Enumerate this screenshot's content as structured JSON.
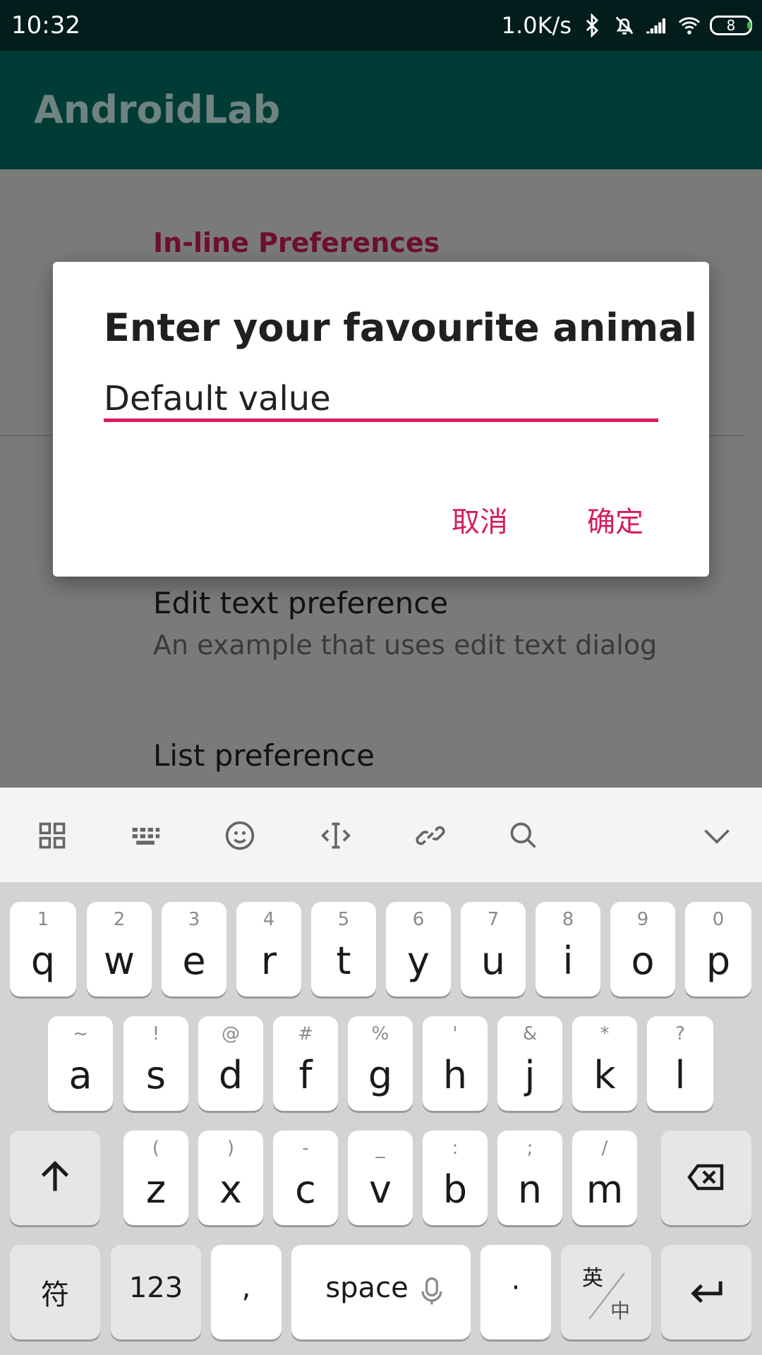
{
  "status_bar": {
    "time": "10:32",
    "network_speed": "1.0K/s",
    "battery_level": "8",
    "icons": [
      "bluetooth-icon",
      "bell-off-icon",
      "signal-icon",
      "wifi-icon",
      "battery-icon"
    ]
  },
  "app_bar": {
    "title": "AndroidLab"
  },
  "preferences": {
    "section_title": "In-line Preferences",
    "items": [
      {
        "title": "Edit text preference",
        "summary": "An example that uses edit text dialog"
      },
      {
        "title": "List preference",
        "summary": ""
      }
    ]
  },
  "dialog": {
    "title": "Enter your favourite animal",
    "input_value": "Default value",
    "cancel_label": "取消",
    "confirm_label": "确定",
    "accent_color": "#d81b60"
  },
  "keyboard": {
    "toolbar_icons": [
      "grid-icon",
      "keyboard-icon",
      "emoji-icon",
      "cursor-icon",
      "link-icon",
      "search-icon",
      "collapse-chevron-icon"
    ],
    "row1": [
      {
        "hint": "1",
        "key": "q"
      },
      {
        "hint": "2",
        "key": "w"
      },
      {
        "hint": "3",
        "key": "e"
      },
      {
        "hint": "4",
        "key": "r"
      },
      {
        "hint": "5",
        "key": "t"
      },
      {
        "hint": "6",
        "key": "y"
      },
      {
        "hint": "7",
        "key": "u"
      },
      {
        "hint": "8",
        "key": "i"
      },
      {
        "hint": "9",
        "key": "o"
      },
      {
        "hint": "0",
        "key": "p"
      }
    ],
    "row2": [
      {
        "hint": "~",
        "key": "a"
      },
      {
        "hint": "!",
        "key": "s"
      },
      {
        "hint": "@",
        "key": "d"
      },
      {
        "hint": "#",
        "key": "f"
      },
      {
        "hint": "%",
        "key": "g"
      },
      {
        "hint": "'",
        "key": "h"
      },
      {
        "hint": "&",
        "key": "j"
      },
      {
        "hint": "*",
        "key": "k"
      },
      {
        "hint": "?",
        "key": "l"
      }
    ],
    "row3": [
      {
        "hint": "(",
        "key": "z"
      },
      {
        "hint": ")",
        "key": "x"
      },
      {
        "hint": "-",
        "key": "c"
      },
      {
        "hint": "_",
        "key": "v"
      },
      {
        "hint": ":",
        "key": "b"
      },
      {
        "hint": ";",
        "key": "n"
      },
      {
        "hint": "/",
        "key": "m"
      }
    ],
    "row4": {
      "symbols_label": "符",
      "numbers_label": "123",
      "comma_label": ",",
      "space_label": "space",
      "period_label": "·",
      "lang_top": "英",
      "lang_bottom": "中"
    }
  }
}
